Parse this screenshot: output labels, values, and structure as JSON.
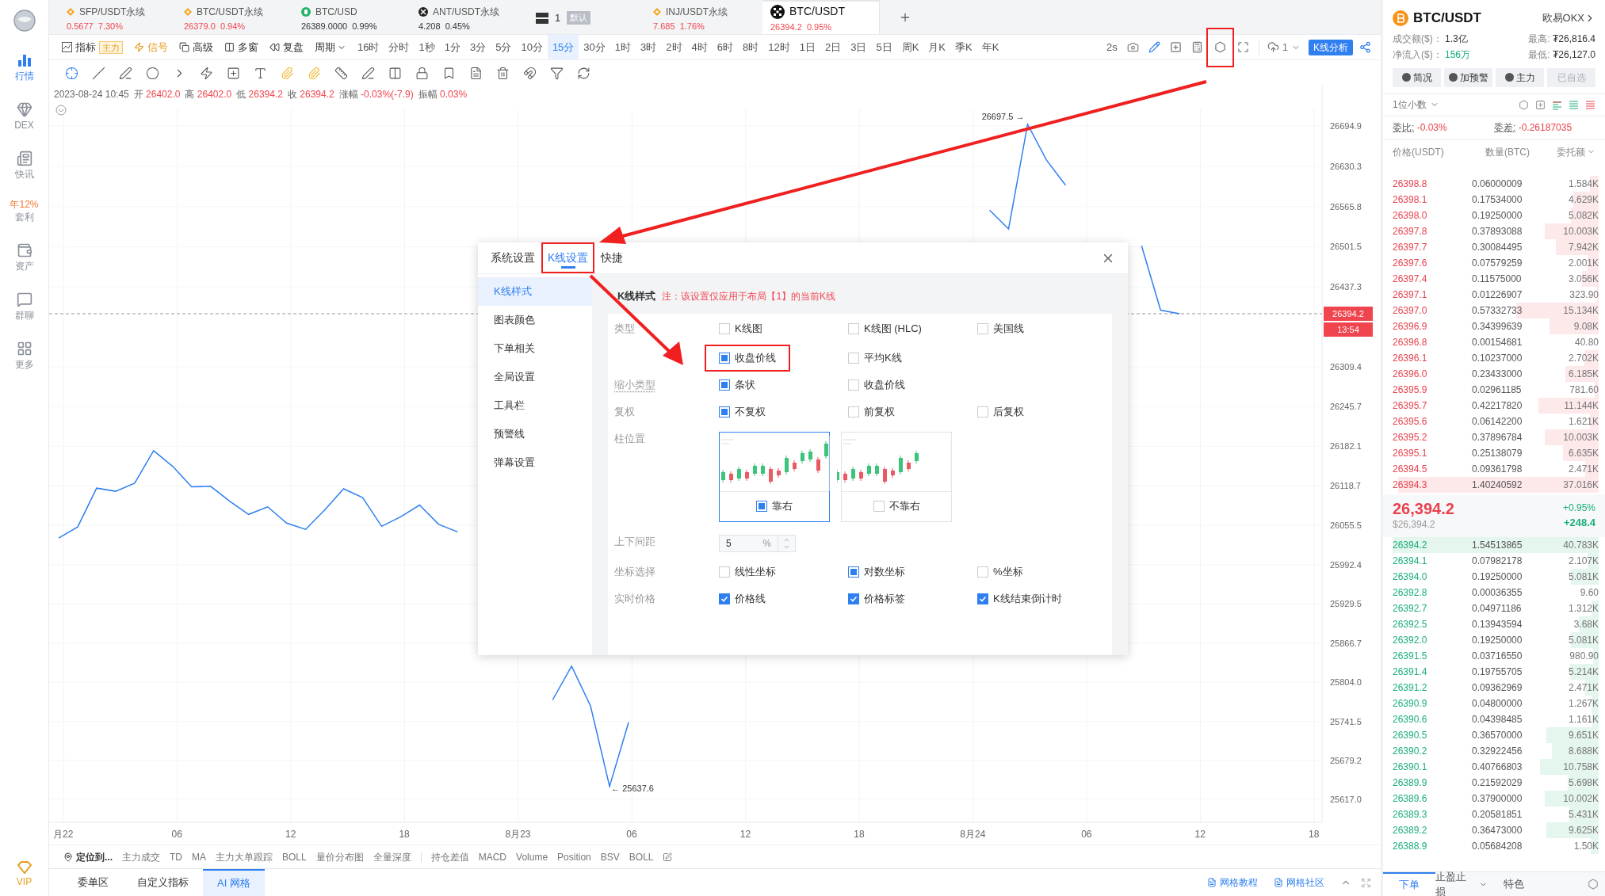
{
  "sidebar": {
    "items": [
      {
        "label": "行情",
        "kind": "bars",
        "selected": true
      },
      {
        "label": "DEX",
        "kind": "dex",
        "selected": false
      },
      {
        "label": "快讯",
        "kind": "news",
        "selected": false
      },
      {
        "label": "套利",
        "kind": "promo",
        "badge": "年12%",
        "selected": false
      },
      {
        "label": "资产",
        "kind": "wallet",
        "selected": false
      },
      {
        "label": "群聊",
        "kind": "chat",
        "selected": false
      },
      {
        "label": "更多",
        "kind": "grid",
        "selected": false
      }
    ],
    "vip": "VIP"
  },
  "tabs": [
    {
      "kind": "diamond",
      "name": "SFP/USDT永续",
      "price": "0.5677",
      "change": "7.30%",
      "color": "#f0454e",
      "selected": false
    },
    {
      "kind": "diamond",
      "name": "BTC/USDT永续",
      "price": "26379.0",
      "change": "0.94%",
      "color": "#f0454e",
      "selected": false
    },
    {
      "kind": "coin",
      "name": "BTC/USD",
      "price": "26389.0000",
      "change": "0.99%",
      "color": "#333333",
      "selected": false
    },
    {
      "kind": "cross",
      "name": "ANT/USDT永续",
      "price": "4.208",
      "change": "0.45%",
      "color": "#333333",
      "selected": false
    },
    {
      "kind": "layout",
      "name": "1",
      "badge": "默认",
      "selected": false
    },
    {
      "kind": "diamond",
      "name": "INJ/USDT永续",
      "price": "7.685",
      "change": "1.76%",
      "color": "#f0454e",
      "selected": false
    },
    {
      "kind": "okx",
      "name": "BTC/USDT",
      "price": "26394.2",
      "change": "0.95%",
      "color": "#f0454e",
      "selected": true
    }
  ],
  "toolbar": {
    "indicator": "指标",
    "indicator_badge": "主力",
    "signal": "信号",
    "advanced": "高级",
    "multi": "多窗",
    "replay": "复盘",
    "period": "周期",
    "periods": [
      {
        "label": "16时",
        "selected": false
      },
      {
        "label": "分时",
        "selected": false
      },
      {
        "label": "1秒",
        "selected": false
      },
      {
        "label": "1分",
        "selected": false
      },
      {
        "label": "3分",
        "selected": false
      },
      {
        "label": "5分",
        "selected": false
      },
      {
        "label": "10分",
        "selected": false
      },
      {
        "label": "15分",
        "selected": true
      },
      {
        "label": "30分",
        "selected": false
      },
      {
        "label": "1时",
        "selected": false
      },
      {
        "label": "3时",
        "selected": false
      },
      {
        "label": "2时",
        "selected": false
      },
      {
        "label": "4时",
        "selected": false
      },
      {
        "label": "6时",
        "selected": false
      },
      {
        "label": "8时",
        "selected": false
      },
      {
        "label": "12时",
        "selected": false
      },
      {
        "label": "1日",
        "selected": false
      },
      {
        "label": "2日",
        "selected": false
      },
      {
        "label": "3日",
        "selected": false
      },
      {
        "label": "5日",
        "selected": false
      },
      {
        "label": "周K",
        "selected": false
      },
      {
        "label": "月K",
        "selected": false
      },
      {
        "label": "季K",
        "selected": false
      },
      {
        "label": "年K",
        "selected": false
      }
    ],
    "refresh": "2s",
    "settings_annotated": true,
    "layout_count": "1",
    "analysis": "K线分析"
  },
  "info": {
    "time": "2023-08-24 10:45",
    "fields": [
      {
        "label": "开",
        "value": "26402.0"
      },
      {
        "label": "高",
        "value": "26402.0"
      },
      {
        "label": "低",
        "value": "26394.2"
      },
      {
        "label": "收",
        "value": "26394.2"
      },
      {
        "label": "涨幅",
        "value": "-0.03%(-7.9)"
      },
      {
        "label": "振幅",
        "value": "0.03%"
      }
    ]
  },
  "chart": {
    "high_label": "26697.5 →",
    "low_label": "← 25637.6",
    "countdown": "13:54",
    "time_axis": [
      "月22",
      "06",
      "12",
      "18",
      "8月23",
      "06",
      "12",
      "18",
      "8月24",
      "06",
      "12",
      "18"
    ],
    "chart_data": {
      "type": "line",
      "ylim": [
        25580,
        26759.5
      ],
      "grid": true,
      "ref_lines": [
        {
          "axis": "y",
          "value": 26394.2,
          "label": "26394.2"
        }
      ],
      "series": [
        {
          "color": "#2f7ff0",
          "values": [
            26035,
            26053,
            26115,
            26110,
            26123,
            26175,
            26150,
            26117,
            26118,
            26094,
            26073,
            26085,
            26059,
            26049,
            26080,
            26114,
            26100,
            26054,
            26069,
            26088,
            26057,
            26045,
            null,
            null,
            null,
            null,
            25776,
            25830,
            25766,
            25637.6,
            25740,
            null,
            null,
            null,
            null,
            null,
            null,
            null,
            null,
            null,
            null,
            null,
            null,
            null,
            null,
            null,
            null,
            null,
            null,
            26560,
            26530,
            26697.5,
            26640,
            26600,
            null,
            null,
            null,
            26503,
            26400,
            26394.2,
            null,
            null,
            null,
            null,
            null,
            null,
            null
          ]
        }
      ],
      "yticks": [
        {
          "value": 26694.9,
          "label": "26694.9"
        },
        {
          "value": 26630.3,
          "label": "26630.3"
        },
        {
          "value": 26565.8,
          "label": "26565.8"
        },
        {
          "value": 26501.5,
          "label": "26501.5"
        },
        {
          "value": 26437.3,
          "label": "26437.3"
        },
        {
          "value": 26309.4,
          "label": "26309.4"
        },
        {
          "value": 26245.7,
          "label": "26245.7"
        },
        {
          "value": 26182.1,
          "label": "26182.1"
        },
        {
          "value": 26118.7,
          "label": "26118.7"
        },
        {
          "value": 26055.5,
          "label": "26055.5"
        },
        {
          "value": 25992.4,
          "label": "25992.4"
        },
        {
          "value": 25929.5,
          "label": "25929.5"
        },
        {
          "value": 25866.7,
          "label": "25866.7"
        },
        {
          "value": 25804.0,
          "label": "25804.0"
        },
        {
          "value": 25741.5,
          "label": "25741.5"
        },
        {
          "value": 25679.2,
          "label": "25679.2"
        },
        {
          "value": 25617.0,
          "label": "25617.0"
        }
      ]
    }
  },
  "indicator_bar": {
    "locate": "定位到...",
    "main": [
      "主力成交",
      "TD",
      "MA",
      "主力大单跟踪",
      "BOLL",
      "量价分布图",
      "全量深度"
    ],
    "sub": [
      "持仓差值",
      "MACD",
      "Volume",
      "Position",
      "BSV",
      "BOLL"
    ]
  },
  "bottom_tabs": [
    {
      "label": "委单区",
      "selected": false
    },
    {
      "label": "自定义指标",
      "selected": false
    },
    {
      "label": "AI 网格",
      "selected": true
    }
  ],
  "bottom_links": [
    "网格教程",
    "网格社区"
  ],
  "dialog": {
    "tabs": [
      {
        "label": "系统设置",
        "selected": false,
        "annotated": false
      },
      {
        "label": "K线设置",
        "selected": true,
        "annotated": true
      },
      {
        "label": "快捷",
        "selected": false,
        "annotated": false
      }
    ],
    "nav": [
      {
        "label": "K线样式",
        "selected": true
      },
      {
        "label": "图表颜色",
        "selected": false
      },
      {
        "label": "下单相关",
        "selected": false
      },
      {
        "label": "全局设置",
        "selected": false
      },
      {
        "label": "工具栏",
        "selected": false
      },
      {
        "label": "预警线",
        "selected": false
      },
      {
        "label": "弹幕设置",
        "selected": false
      }
    ],
    "heading": "K线样式",
    "note": "注：该设置仅应用于布局【1】的当前K线",
    "rows": [
      {
        "kind": "square",
        "label": "类型",
        "hint": false,
        "options": [
          {
            "label": "K线图",
            "checked": false,
            "annotated": false
          },
          {
            "label": "K线图 (HLC)",
            "checked": false,
            "annotated": false
          },
          {
            "label": "美国线",
            "checked": false,
            "annotated": false
          },
          {
            "label": "收盘价线",
            "checked": true,
            "annotated": true
          },
          {
            "label": "平均K线",
            "checked": false,
            "annotated": false
          }
        ]
      },
      {
        "kind": "square",
        "label": "缩小类型",
        "hint": true,
        "options": [
          {
            "label": "条状",
            "checked": true,
            "annotated": false
          },
          {
            "label": "收盘价线",
            "checked": false,
            "annotated": false
          }
        ]
      },
      {
        "kind": "square",
        "label": "复权",
        "hint": false,
        "options": [
          {
            "label": "不复权",
            "checked": true,
            "annotated": false
          },
          {
            "label": "前复权",
            "checked": false,
            "annotated": false
          },
          {
            "label": "后复权",
            "checked": false,
            "annotated": false
          }
        ]
      },
      {
        "kind": "cards",
        "label": "柱位置",
        "hint": false,
        "options": [
          {
            "label": "靠右",
            "checked": true
          },
          {
            "label": "不靠右",
            "checked": false
          }
        ]
      },
      {
        "kind": "number",
        "label": "上下间距",
        "hint": false,
        "value": "5",
        "unit": "%"
      },
      {
        "kind": "square",
        "label": "坐标选择",
        "hint": false,
        "options": [
          {
            "label": "线性坐标",
            "checked": false,
            "annotated": false
          },
          {
            "label": "对数坐标",
            "checked": true,
            "annotated": false
          },
          {
            "label": "%坐标",
            "checked": false,
            "annotated": false
          }
        ]
      },
      {
        "kind": "tick",
        "label": "实时价格",
        "hint": false,
        "options": [
          {
            "label": "价格线",
            "checked": true,
            "annotated": false
          },
          {
            "label": "价格标签",
            "checked": true,
            "annotated": false
          },
          {
            "label": "K线结束倒计时",
            "checked": true,
            "annotated": false
          }
        ]
      }
    ]
  },
  "right_panel": {
    "symbol": "BTC/USDT",
    "exchange": "欧易OKX",
    "stats": [
      {
        "label": "成交额($)：",
        "value": "1.3亿",
        "color": "#333333"
      },
      {
        "label": "最高:",
        "value": "₮26,816.4",
        "color": "#333333"
      },
      {
        "label": "净流入($)：",
        "value": "156万",
        "color": "#1aae7a"
      },
      {
        "label": "最低:",
        "value": "₮26,127.0",
        "color": "#333333"
      }
    ],
    "buttons": [
      {
        "label": "简况",
        "disabled": false
      },
      {
        "label": "加预警",
        "disabled": false
      },
      {
        "label": "主力",
        "disabled": false
      },
      {
        "label": "已自选",
        "disabled": true
      }
    ],
    "precision": "1位小数",
    "ratio_label": "委比:",
    "ratio": "-0.03%",
    "diff_label": "委差:",
    "diff": "-0.26187035",
    "columns": [
      "价格(USDT)",
      "数量(BTC)",
      "委托额"
    ],
    "asks": [
      {
        "price": "26398.8",
        "qty": "0.06000009",
        "amount": "1.584K"
      },
      {
        "price": "26398.1",
        "qty": "0.17534000",
        "amount": "4.629K"
      },
      {
        "price": "26398.0",
        "qty": "0.19250000",
        "amount": "5.082K"
      },
      {
        "price": "26397.8",
        "qty": "0.37893088",
        "amount": "10.003K"
      },
      {
        "price": "26397.7",
        "qty": "0.30084495",
        "amount": "7.942K"
      },
      {
        "price": "26397.6",
        "qty": "0.07579259",
        "amount": "2.001K"
      },
      {
        "price": "26397.4",
        "qty": "0.11575000",
        "amount": "3.056K"
      },
      {
        "price": "26397.1",
        "qty": "0.01226907",
        "amount": "323.90"
      },
      {
        "price": "26397.0",
        "qty": "0.57332733",
        "amount": "15.134K"
      },
      {
        "price": "26396.9",
        "qty": "0.34399639",
        "amount": "9.08K"
      },
      {
        "price": "26396.8",
        "qty": "0.00154681",
        "amount": "40.80"
      },
      {
        "price": "26396.1",
        "qty": "0.10237000",
        "amount": "2.702K"
      },
      {
        "price": "26396.0",
        "qty": "0.23433000",
        "amount": "6.185K"
      },
      {
        "price": "26395.9",
        "qty": "0.02961185",
        "amount": "781.60"
      },
      {
        "price": "26395.7",
        "qty": "0.42217820",
        "amount": "11.144K"
      },
      {
        "price": "26395.6",
        "qty": "0.06142200",
        "amount": "1.621K"
      },
      {
        "price": "26395.2",
        "qty": "0.37896784",
        "amount": "10.003K"
      },
      {
        "price": "26395.1",
        "qty": "0.25138079",
        "amount": "6.635K"
      },
      {
        "price": "26394.5",
        "qty": "0.09361798",
        "amount": "2.471K"
      },
      {
        "price": "26394.3",
        "qty": "1.40240592",
        "amount": "37.016K"
      }
    ],
    "last_price": "26,394.2",
    "last_usd": "$26,394.2",
    "change_pct": "+0.95%",
    "change_abs": "+248.4",
    "bids": [
      {
        "price": "26394.2",
        "qty": "1.54513865",
        "amount": "40.783K"
      },
      {
        "price": "26394.1",
        "qty": "0.07982178",
        "amount": "2.107K"
      },
      {
        "price": "26394.0",
        "qty": "0.19250000",
        "amount": "5.081K"
      },
      {
        "price": "26392.8",
        "qty": "0.00036355",
        "amount": "9.60"
      },
      {
        "price": "26392.7",
        "qty": "0.04971186",
        "amount": "1.312K"
      },
      {
        "price": "26392.5",
        "qty": "0.13943594",
        "amount": "3.68K"
      },
      {
        "price": "26392.0",
        "qty": "0.19250000",
        "amount": "5.081K"
      },
      {
        "price": "26391.5",
        "qty": "0.03716550",
        "amount": "980.90"
      },
      {
        "price": "26391.4",
        "qty": "0.19755705",
        "amount": "5.214K"
      },
      {
        "price": "26391.2",
        "qty": "0.09362969",
        "amount": "2.471K"
      },
      {
        "price": "26390.9",
        "qty": "0.04800000",
        "amount": "1.267K"
      },
      {
        "price": "26390.6",
        "qty": "0.04398485",
        "amount": "1.161K"
      },
      {
        "price": "26390.5",
        "qty": "0.36570000",
        "amount": "9.651K"
      },
      {
        "price": "26390.2",
        "qty": "0.32922456",
        "amount": "8.688K"
      },
      {
        "price": "26390.1",
        "qty": "0.40766803",
        "amount": "10.758K"
      },
      {
        "price": "26389.9",
        "qty": "0.21592029",
        "amount": "5.698K"
      },
      {
        "price": "26389.6",
        "qty": "0.37900000",
        "amount": "10.002K"
      },
      {
        "price": "26389.3",
        "qty": "0.20581851",
        "amount": "5.431K"
      },
      {
        "price": "26389.2",
        "qty": "0.36473000",
        "amount": "9.625K"
      },
      {
        "price": "26388.9",
        "qty": "0.05684208",
        "amount": "1.50K"
      }
    ],
    "bottom_tabs": [
      {
        "label": "下单",
        "selected": true,
        "dropdown": false
      },
      {
        "label": "止盈止损",
        "selected": false,
        "dropdown": true
      },
      {
        "label": "特色",
        "selected": false,
        "dropdown": false
      }
    ]
  }
}
